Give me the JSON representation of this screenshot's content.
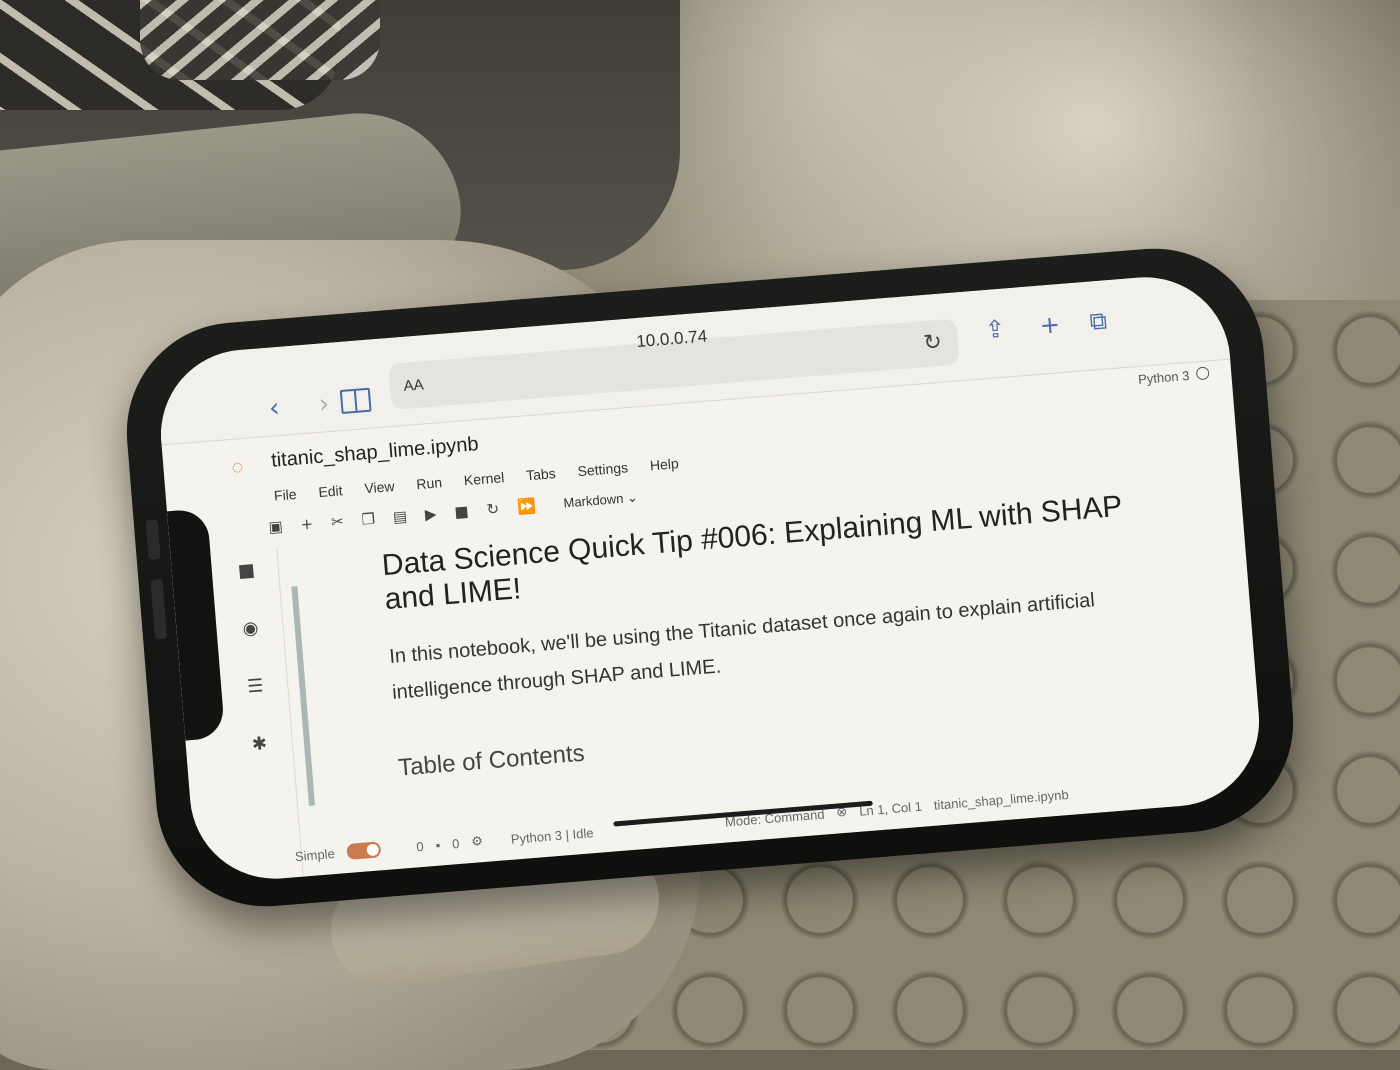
{
  "browser": {
    "back": "‹",
    "forward": "›",
    "reader_label": "AA",
    "url": "10.0.0.74",
    "reload_icon": "reload-icon",
    "share_icon": "share-icon",
    "new_tab": "+",
    "tabs_icon": "tabs-icon"
  },
  "jupyter": {
    "notebook_title": "titanic_shap_lime.ipynb",
    "kernel": "Python 3",
    "menu": [
      "File",
      "Edit",
      "View",
      "Run",
      "Kernel",
      "Tabs",
      "Settings",
      "Help"
    ],
    "cell_type": "Markdown",
    "heading": "Data Science Quick Tip #006: Explaining ML with SHAP and LIME!",
    "paragraph": "In this notebook, we'll be using the Titanic dataset once again to explain artificial intelligence through SHAP and LIME.",
    "subheading": "Table of Contents"
  },
  "status": {
    "mode_label": "Simple",
    "count_a": "0",
    "count_b": "0",
    "kernel_status": "Python 3 | Idle",
    "mode": "Mode: Command",
    "cursor": "Ln 1, Col 1",
    "file": "titanic_shap_lime.ipynb"
  },
  "colors": {
    "accent": "#e46e2e",
    "safari_blue": "#4a6aa3"
  }
}
